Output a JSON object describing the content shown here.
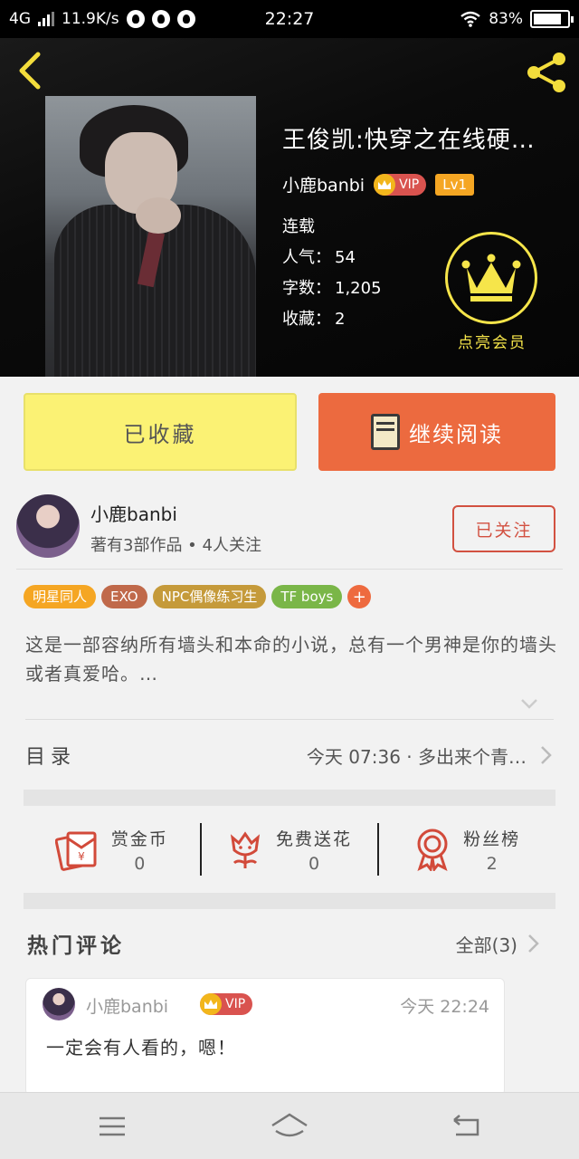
{
  "status_bar": {
    "network": "4G",
    "speed": "11.9K/s",
    "time": "22:27",
    "battery": "83%",
    "battery_level": 0.83
  },
  "book": {
    "title": "王俊凯:快穿之在线硬…",
    "author": "小鹿banbi",
    "vip_label": "VIP",
    "level": "Lv1",
    "status": "连载",
    "popularity_label": "人气：",
    "popularity": "54",
    "words_label": "字数：",
    "words": "1,205",
    "favorites_label": "收藏：",
    "favorites": "2",
    "vip_action": "点亮会员"
  },
  "actions": {
    "favorited": "已收藏",
    "continue_reading": "继续阅读"
  },
  "author_card": {
    "name": "小鹿banbi",
    "summary": "著有3部作品 • 4人关注",
    "follow_label": "已关注"
  },
  "tags": [
    {
      "label": "明星同人",
      "color": "#f5a623"
    },
    {
      "label": "EXO",
      "color": "#c0694a"
    },
    {
      "label": "NPC偶像练习生",
      "color": "#c59a3a"
    },
    {
      "label": "TF boys",
      "color": "#7ab648"
    }
  ],
  "tag_add": "+",
  "description": "这是一部容纳所有墙头和本命的小说，总有一个男神是你的墙头或者真爱哈。…",
  "toc": {
    "label": "目录",
    "latest": "今天 07:36 · 多出来个青…"
  },
  "stats": [
    {
      "label": "赏金币",
      "value": "0",
      "icon": "red-envelope-icon"
    },
    {
      "label": "免费送花",
      "value": "0",
      "icon": "flower-icon"
    },
    {
      "label": "粉丝榜",
      "value": "2",
      "icon": "medal-icon"
    }
  ],
  "comments_section": {
    "heading": "热门评论",
    "all_label": "全部(3)"
  },
  "comment": {
    "user": "小鹿banbi",
    "vip_label": "VIP",
    "time": "今天 22:24",
    "text": "一定会有人看的，嗯！"
  },
  "colors": {
    "accent_yellow": "#fbf274",
    "accent_orange": "#ec6a3f",
    "follow_red": "#d25141",
    "vip_gold": "#f6e54a"
  }
}
